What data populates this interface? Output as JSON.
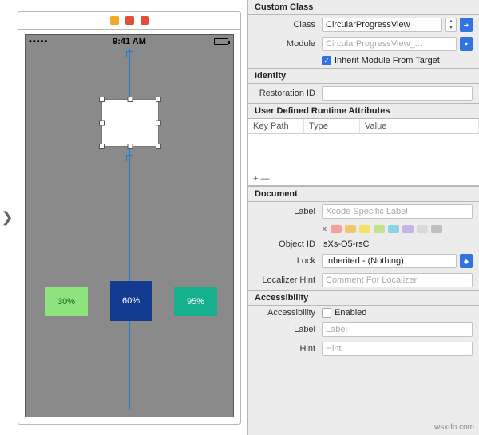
{
  "canvas": {
    "time": "9:41 AM",
    "buttons": {
      "b1": "30%",
      "b2": "60%",
      "b3": "95%"
    },
    "toolbar_icons": [
      "hex-yellow",
      "dismiss-red",
      "embed-red"
    ]
  },
  "inspector": {
    "custom_class_hdr": "Custom Class",
    "class_label": "Class",
    "class_value": "CircularProgressView",
    "module_label": "Module",
    "module_value": "CircularProgressView_...",
    "inherit_label": "Inherit Module From Target",
    "identity_hdr": "Identity",
    "restoration_label": "Restoration ID",
    "restoration_value": "",
    "udra_hdr": "User Defined Runtime Attributes",
    "col_keypath": "Key Path",
    "col_type": "Type",
    "col_value": "Value",
    "addremove": "+   —",
    "document_hdr": "Document",
    "label_label": "Label",
    "label_ph": "Xcode Specific Label",
    "swatch_x": "×",
    "objectid_label": "Object ID",
    "objectid_value": "sXs-O5-rsC",
    "lock_label": "Lock",
    "lock_value": "Inherited - (Nothing)",
    "locahint_label": "Localizer Hint",
    "locahint_ph": "Comment For Localizer",
    "accessibility_hdr": "Accessibility",
    "acc_label": "Accessibility",
    "acc_enabled_label": "Enabled",
    "acc_label_label": "Label",
    "acc_label_ph": "Label",
    "acc_hint_label": "Hint",
    "acc_hint_ph": "Hint"
  },
  "watermark": "wsxdn.com",
  "colors": {
    "swatches": [
      "#f2a1a1",
      "#f4c56b",
      "#f4e36b",
      "#bfe48a",
      "#8bd3e6",
      "#c7b3e6",
      "#d9d9d9",
      "#bfbfbf"
    ]
  }
}
